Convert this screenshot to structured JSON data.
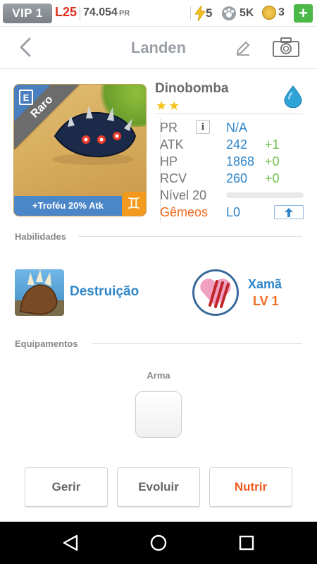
{
  "status": {
    "vip": "VIP 1",
    "level": "L25",
    "pr_value": "74.054",
    "pr_unit": "PR",
    "energy": "5",
    "paw_count": "5K",
    "coins": "3",
    "plus": "+"
  },
  "header": {
    "title": "Landen"
  },
  "monster": {
    "name": "Dinobomba",
    "rarity": "Raro",
    "trophy": "+Troféu 20% Atk",
    "stars": "★★",
    "zodiac_symbol": "♊",
    "element_color": "#2ea3d6"
  },
  "stats": {
    "pr_label": "PR",
    "pr_info": "i",
    "pr_value": "N/A",
    "atk_label": "ATK",
    "atk_value": "242",
    "atk_bonus": "+1",
    "hp_label": "HP",
    "hp_value": "1868",
    "hp_bonus": "+0",
    "rcv_label": "RCV",
    "rcv_value": "260",
    "rcv_bonus": "+0",
    "level_label": "Nível 20",
    "twins_label": "Gêmeos",
    "twins_value": "L0"
  },
  "abilities": {
    "section_title": "Habilidades",
    "skill_name": "Destruição",
    "leader_name": "Xamã",
    "leader_level": "LV 1"
  },
  "equipment": {
    "section_title": "Equipamentos",
    "weapon_label": "Arma"
  },
  "actions": {
    "manage": "Gerir",
    "evolve": "Evoluir",
    "feed": "Nutrir"
  },
  "colors": {
    "accent_blue": "#2f86c9",
    "accent_orange": "#f06a1e",
    "bonus_green": "#6cc14a"
  }
}
